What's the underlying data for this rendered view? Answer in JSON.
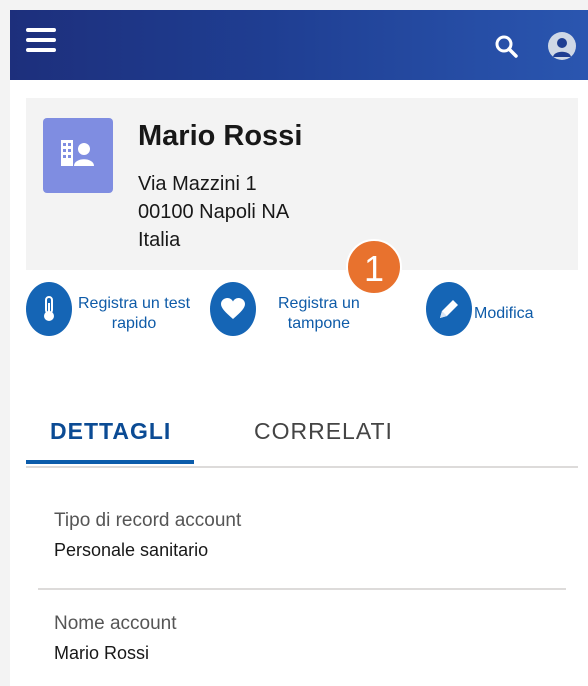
{
  "header": {
    "menu_icon": "hamburger-menu-icon",
    "search_icon": "search-icon",
    "user_icon": "user-avatar-icon"
  },
  "record": {
    "name": "Mario Rossi",
    "address_line1": "Via Mazzini 1",
    "address_line2": "00100 Napoli NA",
    "address_line3": "Italia",
    "icon": "person-account-icon",
    "icon_color": "#7f8de1"
  },
  "annotation": {
    "step_number": "1",
    "color": "#e8722e"
  },
  "actions": [
    {
      "line1": "Registra un test",
      "line2": "rapido",
      "icon": "thermometer-icon"
    },
    {
      "line1": "Registra un",
      "line2": "tampone",
      "icon": "heart-icon"
    },
    {
      "line1": "Modifica",
      "line2": "",
      "icon": "pencil-edit-icon"
    }
  ],
  "tabs": [
    {
      "label": "DETTAGLI",
      "active": true
    },
    {
      "label": "CORRELATI",
      "active": false
    }
  ],
  "fields": [
    {
      "label": "Tipo di record account",
      "value": "Personale sanitario"
    },
    {
      "label": "Nome account",
      "value": "Mario Rossi"
    }
  ],
  "colors": {
    "topbar": "#1f3e92",
    "action_blue": "#1565b5",
    "tab_active": "#0b4b94"
  }
}
